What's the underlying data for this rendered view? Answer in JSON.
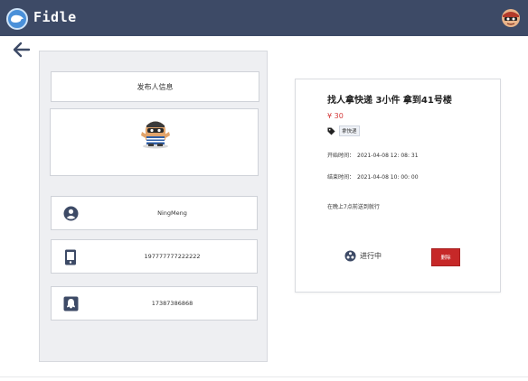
{
  "app": {
    "name": "Fidle"
  },
  "publisher": {
    "title": "发布人信息",
    "name": "NingMeng",
    "phone": "197777777222222",
    "qq": "17387386868"
  },
  "task": {
    "title": "找人拿快递 3小件 拿到41号楼",
    "price": "¥ 30",
    "tag": "拿快递",
    "start_label": "开始时间：",
    "start_time": "2021-04-08  12:  08:  31",
    "end_label": "结束时间：",
    "end_time": "2021-04-08  10:  00:  00",
    "description": "在晚上7点前送到就行",
    "status": "进行中",
    "delete_label": "删除"
  },
  "colors": {
    "header": "#3d4a66",
    "price": "#d43a3a",
    "danger": "#c62828"
  },
  "icons": {
    "back": "arrow-left-icon",
    "user": "user-circle-icon",
    "phone": "phone-icon",
    "qq": "qq-icon",
    "tag": "tag-icon",
    "status": "status-icon"
  }
}
